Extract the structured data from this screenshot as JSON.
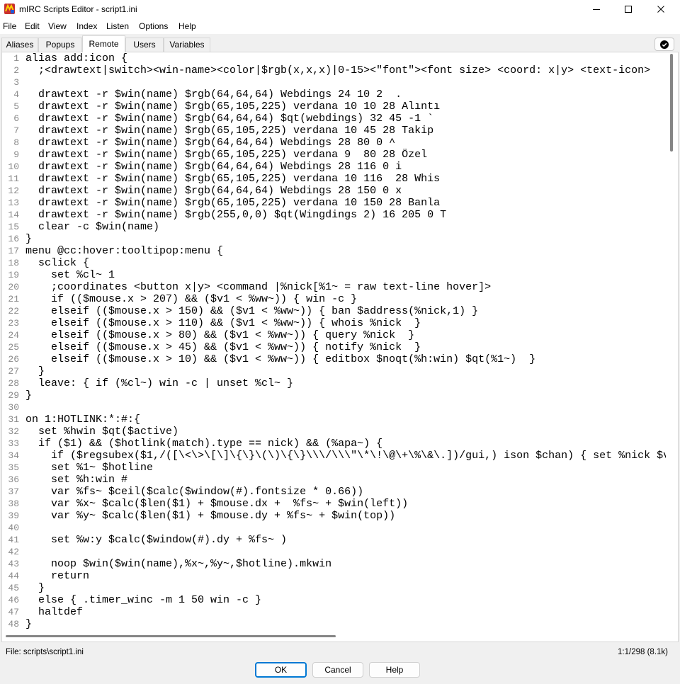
{
  "window": {
    "title": "mIRC Scripts Editor - script1.ini"
  },
  "icons": {
    "app": "mirc-app-icon",
    "minimize": "minimize-icon",
    "maximize": "maximize-icon",
    "close": "close-icon",
    "check": "check-circle-icon"
  },
  "menu": [
    {
      "label": "File"
    },
    {
      "label": "Edit"
    },
    {
      "label": "View"
    },
    {
      "label": "Index"
    },
    {
      "label": "Listen"
    },
    {
      "label": "Options"
    },
    {
      "label": "Help"
    }
  ],
  "tabs": [
    {
      "label": "Aliases",
      "selected": false
    },
    {
      "label": "Popups",
      "selected": false
    },
    {
      "label": "Remote",
      "selected": true
    },
    {
      "label": "Users",
      "selected": false
    },
    {
      "label": "Variables",
      "selected": false
    }
  ],
  "editor": {
    "lines": [
      {
        "n": 1,
        "text": "alias add:icon {"
      },
      {
        "n": 2,
        "text": "  ;<drawtext|switch><win-name><color|$rgb(x,x,x)|0-15><\"font\"><font size> <coord: x|y> <text-icon>"
      },
      {
        "n": 3,
        "text": ""
      },
      {
        "n": 4,
        "text": "  drawtext -r $win(name) $rgb(64,64,64) Webdings 24 10 2  ."
      },
      {
        "n": 5,
        "text": "  drawtext -r $win(name) $rgb(65,105,225) verdana 10 10 28 Alıntı"
      },
      {
        "n": 6,
        "text": "  drawtext -r $win(name) $rgb(64,64,64) $qt(webdings) 32 45 -1 `"
      },
      {
        "n": 7,
        "text": "  drawtext -r $win(name) $rgb(65,105,225) verdana 10 45 28 Takip"
      },
      {
        "n": 8,
        "text": "  drawtext -r $win(name) $rgb(64,64,64) Webdings 28 80 0 ^"
      },
      {
        "n": 9,
        "text": "  drawtext -r $win(name) $rgb(65,105,225) verdana 9  80 28 Özel"
      },
      {
        "n": 10,
        "text": "  drawtext -r $win(name) $rgb(64,64,64) Webdings 28 116 0 i"
      },
      {
        "n": 11,
        "text": "  drawtext -r $win(name) $rgb(65,105,225) verdana 10 116  28 Whis"
      },
      {
        "n": 12,
        "text": "  drawtext -r $win(name) $rgb(64,64,64) Webdings 28 150 0 x"
      },
      {
        "n": 13,
        "text": "  drawtext -r $win(name) $rgb(65,105,225) verdana 10 150 28 Banla"
      },
      {
        "n": 14,
        "text": "  drawtext -r $win(name) $rgb(255,0,0) $qt(Wingdings 2) 16 205 0 T"
      },
      {
        "n": 15,
        "text": "  clear -c $win(name)"
      },
      {
        "n": 16,
        "text": "}"
      },
      {
        "n": 17,
        "text": "menu @cc:hover:tooltipop:menu {"
      },
      {
        "n": 18,
        "text": "  sclick {"
      },
      {
        "n": 19,
        "text": "    set %cl~ 1"
      },
      {
        "n": 20,
        "text": "    ;coordinates <button x|y> <command |%nick[%1~ = raw text-line hover]>"
      },
      {
        "n": 21,
        "text": "    if (($mouse.x > 207) && ($v1 < %ww~)) { win -c }"
      },
      {
        "n": 22,
        "text": "    elseif (($mouse.x > 150) && ($v1 < %ww~)) { ban $address(%nick,1) }"
      },
      {
        "n": 23,
        "text": "    elseif (($mouse.x > 110) && ($v1 < %ww~)) { whois %nick  }"
      },
      {
        "n": 24,
        "text": "    elseif (($mouse.x > 80) && ($v1 < %ww~)) { query %nick  }"
      },
      {
        "n": 25,
        "text": "    elseif (($mouse.x > 45) && ($v1 < %ww~)) { notify %nick  }"
      },
      {
        "n": 26,
        "text": "    elseif (($mouse.x > 10) && ($v1 < %ww~)) { editbox $noqt(%h:win) $qt(%1~)  }"
      },
      {
        "n": 27,
        "text": "  }"
      },
      {
        "n": 28,
        "text": "  leave: { if (%cl~) win -c | unset %cl~ }"
      },
      {
        "n": 29,
        "text": "}"
      },
      {
        "n": 30,
        "text": ""
      },
      {
        "n": 31,
        "text": "on 1:HOTLINK:*:#:{"
      },
      {
        "n": 32,
        "text": "  set %hwin $qt($active)"
      },
      {
        "n": 33,
        "text": "  if ($1) && ($hotlink(match).type == nick) && (%apa~) {"
      },
      {
        "n": 34,
        "text": "    if ($regsubex($1,/([\\<\\>\\[\\]\\{\\}\\(\\)\\{\\}\\\\\\/\\\\\\\"\\*\\!\\@\\+\\%\\&\\.])/gui,) ison $chan) { set %nick $v"
      },
      {
        "n": 35,
        "text": "    set %1~ $hotline"
      },
      {
        "n": 36,
        "text": "    set %h:win #"
      },
      {
        "n": 37,
        "text": "    var %fs~ $ceil($calc($window(#).fontsize * 0.66))"
      },
      {
        "n": 38,
        "text": "    var %x~ $calc($len($1) + $mouse.dx +  %fs~ + $win(left))"
      },
      {
        "n": 39,
        "text": "    var %y~ $calc($len($1) + $mouse.dy + %fs~ + $win(top))"
      },
      {
        "n": 40,
        "text": ""
      },
      {
        "n": 41,
        "text": "    set %w:y $calc($window(#).dy + %fs~ )"
      },
      {
        "n": 42,
        "text": ""
      },
      {
        "n": 43,
        "text": "    noop $win($win(name),%x~,%y~,$hotline).mkwin"
      },
      {
        "n": 44,
        "text": "    return"
      },
      {
        "n": 45,
        "text": "  }"
      },
      {
        "n": 46,
        "text": "  else { .timer_winc -m 1 50 win -c }"
      },
      {
        "n": 47,
        "text": "  haltdef"
      },
      {
        "n": 48,
        "text": "}"
      }
    ]
  },
  "status": {
    "file": "File: scripts\\script1.ini",
    "position": "1:1/298 (8.1k)"
  },
  "buttons": {
    "ok": "OK",
    "cancel": "Cancel",
    "help": "Help"
  },
  "theme": {
    "accent": "#0078d4",
    "code_text": "#000000",
    "line_number": "#8a8a8a",
    "editor_bg": "#ffffff",
    "window_bg": "#f0f0f0"
  }
}
